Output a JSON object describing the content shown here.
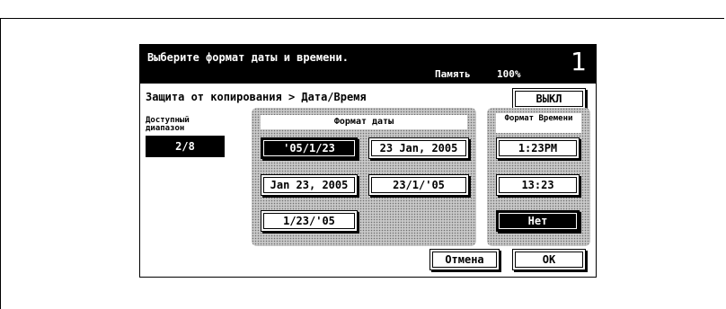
{
  "header": {
    "instruction": "Выберите формат даты и времени.",
    "memory_label": "Память",
    "memory_value": "100%",
    "copies": "1"
  },
  "breadcrumb": "Защита от копирования > Дата/Время",
  "off_button": "ВЫКЛ",
  "range": {
    "label": "Доступный диапазон",
    "value": "2/8"
  },
  "date_format": {
    "title": "Формат даты",
    "options": [
      "'05/1/23",
      "23 Jan, 2005",
      "Jan 23, 2005",
      "23/1/'05",
      "1/23/'05"
    ],
    "selected": "'05/1/23"
  },
  "time_format": {
    "title": "Формат Времени",
    "options": [
      "1:23PM",
      "13:23",
      "Нет"
    ],
    "selected": "Нет"
  },
  "footer": {
    "cancel": "Отмена",
    "ok": "OK"
  },
  "colors": {
    "panel_bg": "#ffffff",
    "header_bg": "#000000",
    "dither_light": "#c8c8c8",
    "dither_dark": "#6e6e6e"
  }
}
